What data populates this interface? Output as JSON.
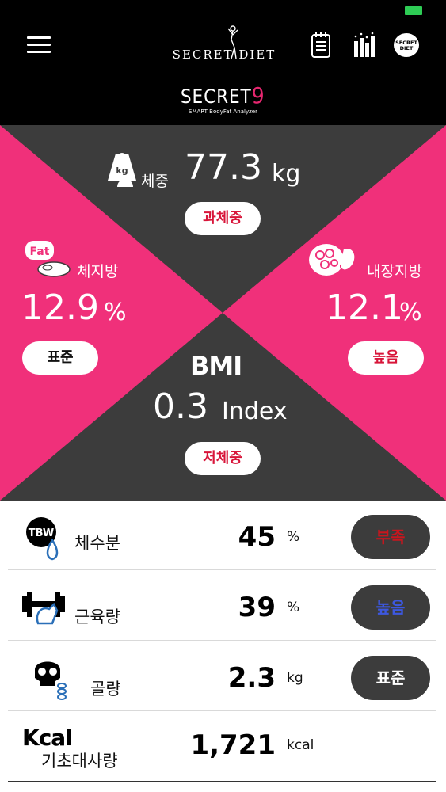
{
  "header": {
    "logo_text": "SECRET DIET",
    "sub_logo_main": "SECRET",
    "sub_logo_number": "9",
    "sub_logo_caption": "SMART BodyFat Analyzer",
    "brand_badge": "SECRET DIET",
    "icons": [
      "hamburger-icon",
      "diary-icon",
      "chart-icon",
      "brand-icon"
    ]
  },
  "weight": {
    "label": "체중",
    "value": "77.3",
    "unit": "kg",
    "status": "과체중",
    "icon_text": "kg"
  },
  "body_fat": {
    "label": "체지방",
    "value": "12.9",
    "unit": "%",
    "status": "표준",
    "icon_text": "Fat"
  },
  "visceral_fat": {
    "label": "내장지방",
    "value": "12.1",
    "unit": "%",
    "status": "높음"
  },
  "bmi": {
    "label": "BMI",
    "value": "0.3",
    "unit": "Index",
    "status": "저체중"
  },
  "metrics": [
    {
      "label": "체수분",
      "value": "45",
      "unit": "%",
      "status": "부족",
      "status_color": "#c8161e",
      "icon_text": "TBW"
    },
    {
      "label": "근육량",
      "value": "39",
      "unit": "%",
      "status": "높음",
      "status_color": "#3d58e0"
    },
    {
      "label": "골량",
      "value": "2.3",
      "unit": "kg",
      "status": "표준",
      "status_color": "#ffffff"
    },
    {
      "label": "기초대사량",
      "value": "1,721",
      "unit": "kcal",
      "icon_text": "Kcal"
    }
  ],
  "colors": {
    "pink": "#f0307a",
    "dark": "#3c3c3c",
    "header": "#000000"
  }
}
